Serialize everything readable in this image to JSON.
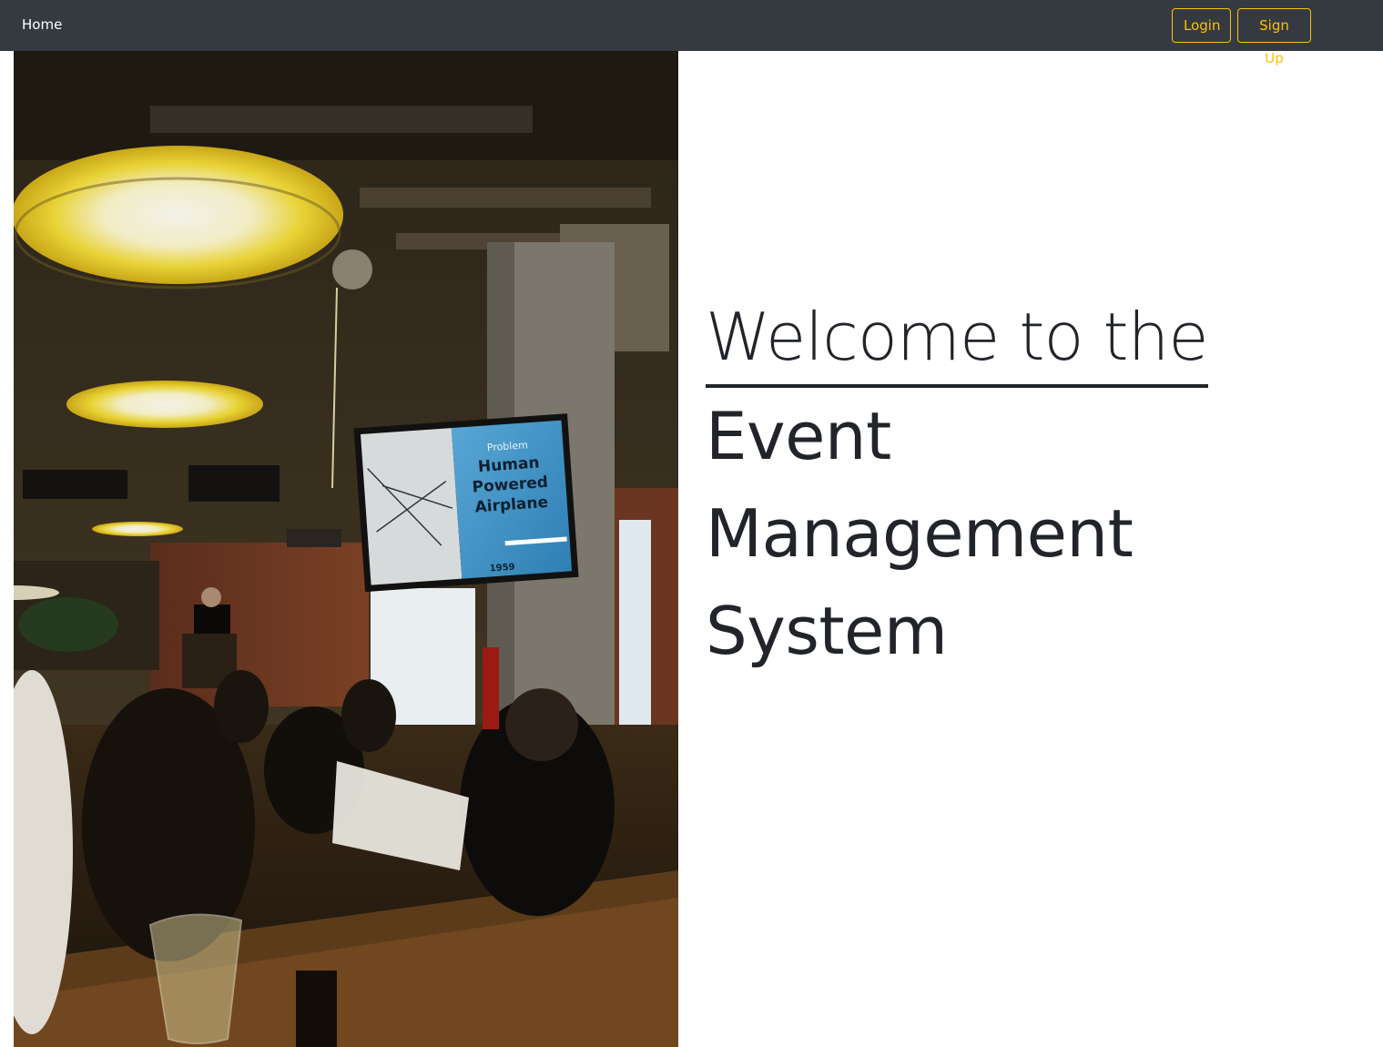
{
  "navbar": {
    "home_label": "Home",
    "login_label": "Login",
    "signup_label": "Sign Up",
    "accent_color": "#ffc107",
    "background_color": "#343a40"
  },
  "hero": {
    "headline_line1": "Welcome to the",
    "headline_line2": "Event",
    "headline_line3": "Management",
    "headline_line4": "System"
  },
  "photo": {
    "screen_text": {
      "label": "Problem",
      "line1": "Human",
      "line2": "Powered",
      "line3": "Airplane",
      "year": "1959"
    }
  }
}
